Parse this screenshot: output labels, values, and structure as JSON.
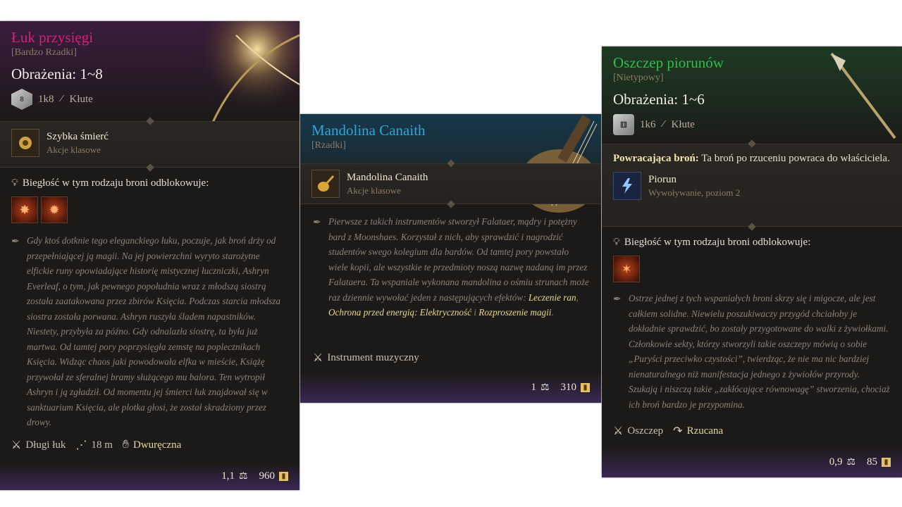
{
  "cards": {
    "bow": {
      "title": "Łuk przysięgi",
      "rarity": "[Bardzo Rzadki]",
      "damage": "Obrażenia: 1~8",
      "dice_face": "8",
      "dice": "1k8",
      "damage_type": "Kłute",
      "action": {
        "name": "Szybka śmierć",
        "sub": "Akcje klasowe"
      },
      "proficiency": "Biegłość w tym rodzaju broni odblokowuje:",
      "description": "Gdy ktoś dotknie tego eleganckiego łuku, poczuje, jak broń drży od przepełniającej ją magii. Na jej powierzchni wyryto starożytne elfickie runy opowiadające historię mistycznej łuczniczki, Ashryn Everleaf, o tym, jak pewnego popołudnia wraz z młodszą siostrą została zaatakowana przez zbirów Księcia. Podczas starcia młodsza siostra została porwana. Ashryn ruszyła śladem napastników. Niestety, przybyła za późno. Gdy odnalazła siostrę, ta była już martwa. Od tamtej pory poprzysięgła zemstę na poplecznikach Księcia. Widząc chaos jaki powodowała elfka w mieście, Książę przywołał ze sferalnej bramy służącego mu balora. Ten wytropił Ashryn i ją zgładził. Od momentu jej śmierci łuk znajdował się w sanktuarium Księcia, ale plotka głosi, że został skradziony przez drowy.",
      "props": {
        "type": "Długi łuk",
        "range": "18 m",
        "hands": "Dwuręczna"
      },
      "weight": "1,1",
      "price": "960",
      "title_color": "#d6207a"
    },
    "mandolin": {
      "title": "Mandolina Canaith",
      "rarity": "[Rzadki]",
      "action": {
        "name": "Mandolina Canaith",
        "sub": "Akcje klasowe"
      },
      "description_pre": "Pierwsze z takich instrumentów stworzył Falataer, mądry i potężny bard z Moonshaes. Korzystał z nich, aby sprawdzić i nagrodzić studentów swego kolegium dla bardów. Od tamtej pory powstało wiele kopii, ale wszystkie te przedmioty noszą nazwę nadaną im przez Falataera. Ta wspaniale wykonana mandolina o ośmiu strunach może raz dziennie wywołać jeden z następujących efektów: ",
      "spell1": "Leczenie ran",
      "sep1": ", ",
      "spell2": "Ochrona przed energią: Elektryczność",
      "sep2": " i ",
      "spell3": "Rozproszenie magii",
      "end": ".",
      "props": {
        "type": "Instrument muzyczny"
      },
      "weight": "1",
      "price": "310",
      "title_color": "#2aa7dc"
    },
    "spear": {
      "title": "Oszczep piorunów",
      "rarity": "[Nietypowy]",
      "damage": "Obrażenia: 1~6",
      "dice": "1k6",
      "damage_type": "Kłute",
      "returning_label": "Powracająca broń:",
      "returning_text": " Ta broń po rzuceniu powraca do właściciela.",
      "spell": {
        "name": "Piorun",
        "sub": "Wywoływanie, poziom 2"
      },
      "proficiency": "Biegłość w tym rodzaju broni odblokowuje:",
      "description": "Ostrze jednej z tych wspaniałych broni skrzy się i migocze, ale jest całkiem solidne. Niewielu poszukiwaczy przygód chciałoby je dokładnie sprawdzić, bo zostały przygotowane do walki z żywiołkami. Członkowie sekty, którzy stworzyli takie oszczepy mówią o sobie „Puryści przeciwko czystości”, twierdząc, że nie ma nic bardziej nienaturalnego niż manifestacja jednego z żywiołów przyrody. Szukają i niszczą takie „zakłócające równowagę” stworzenia, chociaż ich broń bardzo je przypomina.",
      "props": {
        "type": "Oszczep",
        "thrown": "Rzucana"
      },
      "weight": "0,9",
      "price": "85",
      "title_color": "#2fbf4a"
    }
  },
  "icons": {
    "weight": "weight-icon",
    "coin": "coin-icon",
    "weapon_type": "crossed-swords-icon",
    "quill": "quill-icon",
    "proficiency": "lightbulb-icon"
  }
}
